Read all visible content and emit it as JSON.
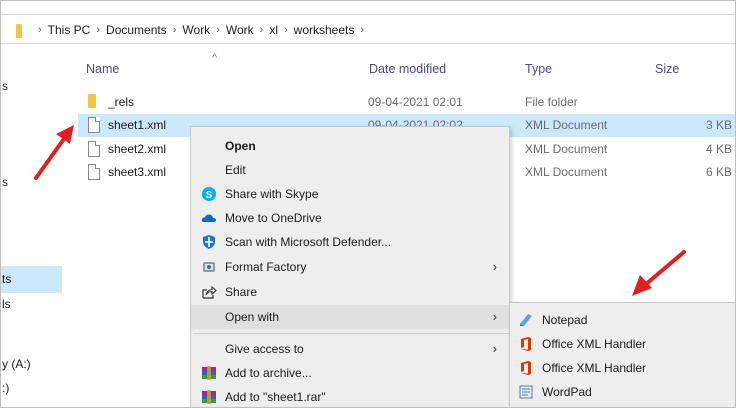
{
  "breadcrumb": {
    "items": [
      "This PC",
      "Documents",
      "Work",
      "Work",
      "xl",
      "worksheets"
    ]
  },
  "left_nav": {
    "fragments": [
      "s",
      "s",
      "ts",
      "ls",
      "y (A:)",
      ":)"
    ]
  },
  "columns": {
    "name": "Name",
    "date_modified": "Date modified",
    "type": "Type",
    "size": "Size"
  },
  "files": [
    {
      "name": "_rels",
      "date": "09-04-2021 02:01",
      "type": "File folder",
      "size": "",
      "icon": "folder-icon"
    },
    {
      "name": "sheet1.xml",
      "date": "09-04-2021 02:02",
      "type": "XML Document",
      "size": "3 KB",
      "icon": "document-icon",
      "selected": true
    },
    {
      "name": "sheet2.xml",
      "date": "",
      "type": "XML Document",
      "size": "4 KB",
      "icon": "document-icon"
    },
    {
      "name": "sheet3.xml",
      "date": "",
      "type": "XML Document",
      "size": "6 KB",
      "icon": "document-icon"
    }
  ],
  "context_menu": {
    "items": [
      {
        "label": "Open",
        "icon": "",
        "bold": true
      },
      {
        "label": "Edit",
        "icon": ""
      },
      {
        "label": "Share with Skype",
        "icon": "skype-icon"
      },
      {
        "label": "Move to OneDrive",
        "icon": "onedrive-cloud-icon"
      },
      {
        "label": "Scan with Microsoft Defender...",
        "icon": "defender-shield-icon"
      },
      {
        "label": "Format Factory",
        "icon": "format-factory-icon",
        "submenu": true
      },
      {
        "label": "Share",
        "icon": "share-icon"
      },
      {
        "label": "Open with",
        "icon": "",
        "submenu": true,
        "highlighted": true
      },
      {
        "label": "Give access to",
        "icon": "",
        "submenu": true
      },
      {
        "label": "Add to archive...",
        "icon": "winrar-icon"
      },
      {
        "label": "Add to \"sheet1.rar\"",
        "icon": "winrar-icon"
      }
    ]
  },
  "open_with_submenu": {
    "items": [
      {
        "label": "Notepad",
        "icon": "notepad-icon"
      },
      {
        "label": "Office XML Handler",
        "icon": "office-icon"
      },
      {
        "label": "Office XML Handler",
        "icon": "office-icon"
      },
      {
        "label": "WordPad",
        "icon": "wordpad-icon"
      }
    ]
  },
  "colors": {
    "selection": "#cce8ff",
    "menu_bg": "#eeeeee",
    "annotation_red": "#e02020",
    "folder_yellow": "#f2c64b",
    "skype_blue": "#00aff0",
    "onedrive_blue": "#0f6cbd",
    "office_orange": "#d83b01"
  }
}
